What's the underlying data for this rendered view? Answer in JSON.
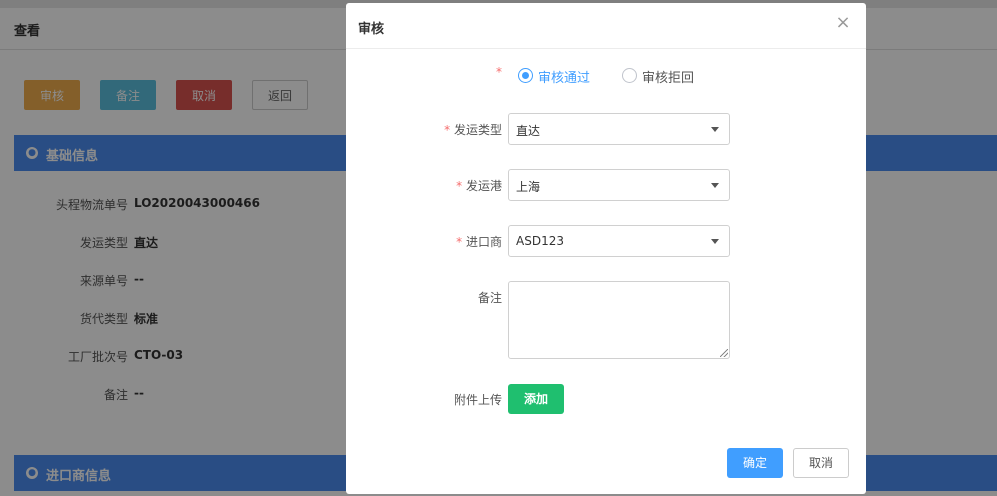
{
  "page": {
    "title": "查看",
    "buttons": {
      "audit": "审核",
      "note": "备注",
      "cancel": "取消",
      "back": "返回"
    },
    "basic_section": {
      "title": "基础信息",
      "rows": [
        {
          "label": "头程物流单号",
          "value": "LO2020043000466"
        },
        {
          "label": "发运类型",
          "value": "直达"
        },
        {
          "label": "来源单号",
          "value": "--"
        },
        {
          "label": "货代类型",
          "value": "标准"
        },
        {
          "label": "工厂批次号",
          "value": "CTO-03"
        },
        {
          "label": "备注",
          "value": "--"
        }
      ]
    },
    "importer_section": {
      "title": "进口商信息"
    }
  },
  "modal": {
    "title": "审核",
    "close_symbol": "×",
    "required_mark": "*",
    "audit_result": {
      "options": [
        "审核通过",
        "审核拒回"
      ],
      "selected": "审核通过"
    },
    "shipping_type": {
      "label": "发运类型",
      "value": "直达"
    },
    "port": {
      "label": "发运港",
      "value": "上海"
    },
    "importer": {
      "label": "进口商",
      "value": "ASD123"
    },
    "remark": {
      "label": "备注",
      "value": ""
    },
    "attachment": {
      "label": "附件上传",
      "button": "添加"
    },
    "confirm": "确定",
    "cancel": "取消"
  },
  "colors": {
    "primary": "#409eff",
    "section_bar": "#4b8df0",
    "audit_button": "#f0ad4e",
    "note_button": "#5bc0de",
    "cancel_button": "#d9534f",
    "add_button": "#1fbf6f",
    "required": "#f56c6c"
  }
}
